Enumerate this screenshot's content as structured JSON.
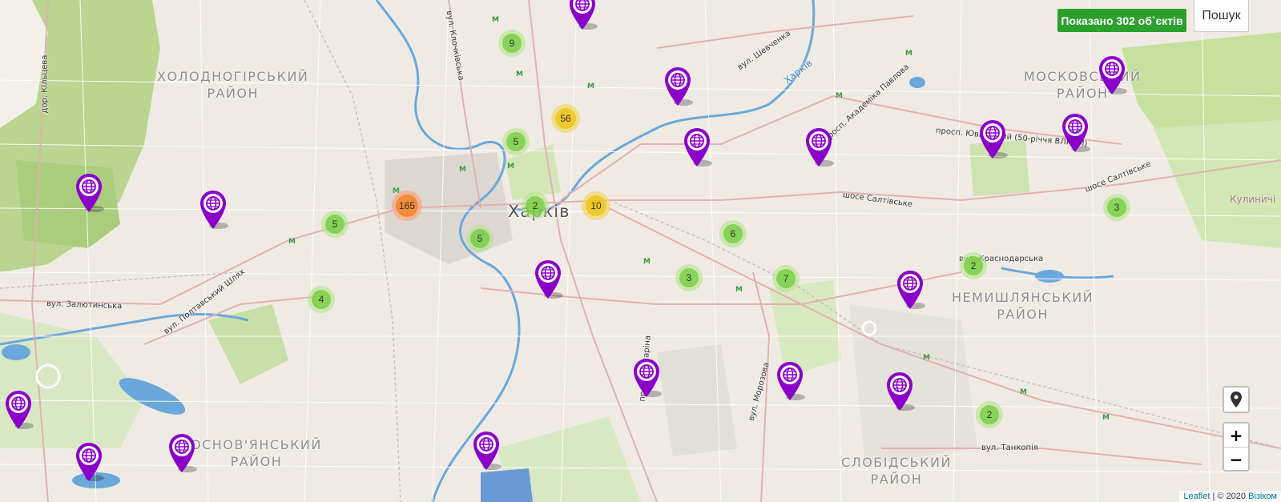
{
  "map": {
    "city_label": "Харків",
    "districts": [
      "Холодногірський\nрайон",
      "Московський\nрайон",
      "Немишлянський\nрайон",
      "Основ'янський\nрайон",
      "Слобідський\nрайон"
    ],
    "streets": [
      "вул. Шевченка",
      "просп. Академіка Павлова",
      "просп. Ювілейний (50-річчя ВЛКСМ)",
      "шосе Салтівське",
      "шосе Салтівське",
      "вул. Краснодарська",
      "вул. Залютинська",
      "вул. Полтавський Шлях",
      "дор. Кільцева",
      "вул. Клочківська",
      "вул. Морозова",
      "просп. Гагаріна",
      "вул. Танкопія"
    ],
    "river_label": "Харків",
    "town_label": "Кулиничі",
    "metro_glyph": "M"
  },
  "clusters": [
    {
      "count": "9",
      "tier": "small"
    },
    {
      "count": "56",
      "tier": "medium"
    },
    {
      "count": "5",
      "tier": "small"
    },
    {
      "count": "165",
      "tier": "large"
    },
    {
      "count": "2",
      "tier": "small"
    },
    {
      "count": "10",
      "tier": "medium"
    },
    {
      "count": "5",
      "tier": "small"
    },
    {
      "count": "5",
      "tier": "small"
    },
    {
      "count": "4",
      "tier": "small"
    },
    {
      "count": "6",
      "tier": "small"
    },
    {
      "count": "3",
      "tier": "small"
    },
    {
      "count": "7",
      "tier": "small"
    },
    {
      "count": "3",
      "tier": "small"
    },
    {
      "count": "2",
      "tier": "small"
    },
    {
      "count": "2",
      "tier": "small"
    }
  ],
  "markers": {
    "icon": "globe-icon",
    "color": "#8b00c8",
    "count": 19
  },
  "controls": {
    "counter_text": "Показано 302 об`єктів",
    "search_label": "Пошук",
    "locate_icon": "location-pin-icon",
    "zoom_in": "+",
    "zoom_out": "−"
  },
  "attribution": {
    "leaflet": "Leaflet",
    "sep": " | ",
    "copyright": "© 2020 ",
    "provider": "Візіком"
  },
  "colors": {
    "park": "#c8dfa8",
    "forest": "#b4d48a",
    "water": "#6aa8dc",
    "road": "#e0a8a8",
    "counter_bg": "#2ca02c",
    "cluster_small": "#6ecc39",
    "cluster_medium": "#f0c20c",
    "cluster_large": "#f18017"
  }
}
